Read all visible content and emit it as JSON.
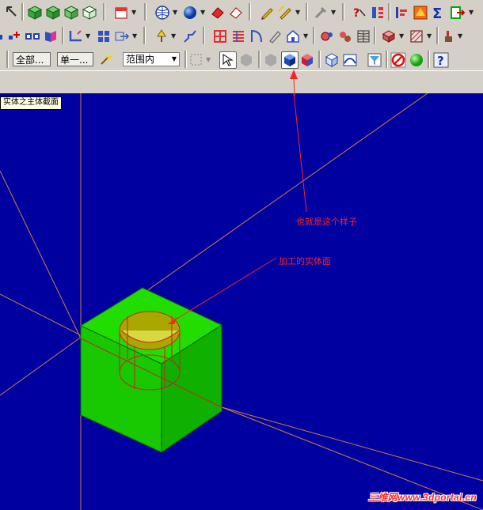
{
  "toolbar3": {
    "all_button": "全部...",
    "single_button": "单一...",
    "range_select": "范围内"
  },
  "tooltip": "实体之主体截面",
  "annotations": {
    "this_style": "也就是这个样子",
    "machined_face": "加工的实体面"
  },
  "watermark": "三维网www.3dportal.cn",
  "colors": {
    "viewport_bg": "#0000a0",
    "toolbar_bg": "#d4d0c8",
    "solid_top": "#22dd00",
    "solid_left": "#18c800",
    "solid_right": "#10b000",
    "annotation": "#ff2020",
    "axis": "#d08040"
  },
  "icons": [
    "cube-green-icon",
    "cube-outline-icon",
    "sphere-icon",
    "eraser-icon",
    "pencil-icon",
    "pointer-icon",
    "zoom-icon",
    "sigma-icon",
    "export-icon",
    "grid-icon",
    "table-icon",
    "arc-icon",
    "select-arrow-icon",
    "shaded-cube-icon",
    "wire-cube-icon",
    "stop-icon",
    "green-ball-icon",
    "help-icon"
  ]
}
